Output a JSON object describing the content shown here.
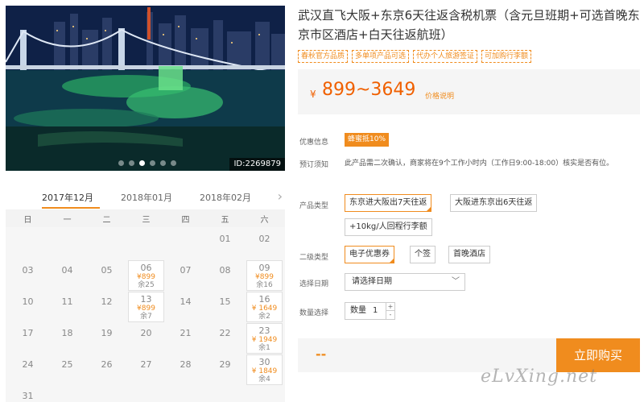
{
  "hero": {
    "image_id": "ID:2269879",
    "slides": 6,
    "active_slide": 3
  },
  "calendar": {
    "months": [
      "2017年12月",
      "2018年01月",
      "2018年02月"
    ],
    "active_month": "2017年12月",
    "weekdays": [
      "日",
      "一",
      "二",
      "三",
      "四",
      "五",
      "六"
    ],
    "rows": [
      [
        {
          "d": ""
        },
        {
          "d": ""
        },
        {
          "d": ""
        },
        {
          "d": ""
        },
        {
          "d": ""
        },
        {
          "d": "01"
        },
        {
          "d": "02"
        }
      ],
      [
        {
          "d": "03"
        },
        {
          "d": "04"
        },
        {
          "d": "05"
        },
        {
          "d": "06",
          "price": "¥899",
          "remain": "余25"
        },
        {
          "d": "07"
        },
        {
          "d": "08"
        },
        {
          "d": "09",
          "price": "¥899",
          "remain": "余16"
        }
      ],
      [
        {
          "d": "10"
        },
        {
          "d": "11"
        },
        {
          "d": "12"
        },
        {
          "d": "13",
          "price": "¥899",
          "remain": "余7"
        },
        {
          "d": "14"
        },
        {
          "d": "15"
        },
        {
          "d": "16",
          "price": "¥ 1649",
          "remain": "余2"
        }
      ],
      [
        {
          "d": "17"
        },
        {
          "d": "18"
        },
        {
          "d": "19"
        },
        {
          "d": "20"
        },
        {
          "d": "21"
        },
        {
          "d": "22"
        },
        {
          "d": "23",
          "price": "¥ 1949",
          "remain": "余1"
        }
      ],
      [
        {
          "d": "24"
        },
        {
          "d": "25"
        },
        {
          "d": "26"
        },
        {
          "d": "27"
        },
        {
          "d": "28"
        },
        {
          "d": "29"
        },
        {
          "d": "30",
          "price": "¥ 1849",
          "remain": "余4"
        }
      ],
      [
        {
          "d": "31"
        }
      ]
    ]
  },
  "product": {
    "title": "武汉直飞大阪+东京6天往返含税机票（含元旦班期+可选首晚东京市区酒店+白天往返航班）",
    "tags": [
      "春秋官方品质",
      "多单项产品可选",
      "代办个人旅游签证",
      "可加购行李额"
    ],
    "currency": "¥",
    "price": "899~3649",
    "price_note": "价格说明",
    "discount_label": "优惠信息",
    "discount_badge": "蜂蜜抵10%",
    "notice_label": "预订须知",
    "notice_text": "此产品需二次确认，商家将在9个工作小时内（工作日9:00-18:00）核实是否有位。",
    "type_label": "产品类型",
    "type_options": [
      "东京进大阪出7天往返",
      "大阪进东京出6天往返",
      "+10kg/人回程行李额"
    ],
    "type_selected": "东京进大阪出7天往返",
    "subtype_label": "二级类型",
    "subtype_options": [
      "电子优惠券",
      "个签",
      "首晚酒店"
    ],
    "subtype_selected": "电子优惠券",
    "date_label": "选择日期",
    "date_placeholder": "请选择日期",
    "qty_label": "数量选择",
    "qty_text": "数量",
    "qty_value": "1",
    "total": "--",
    "buy_label": "立即购买"
  },
  "watermark": "eLvXing.net",
  "colors": {
    "accent": "#f08c1e",
    "price": "#f06000"
  }
}
